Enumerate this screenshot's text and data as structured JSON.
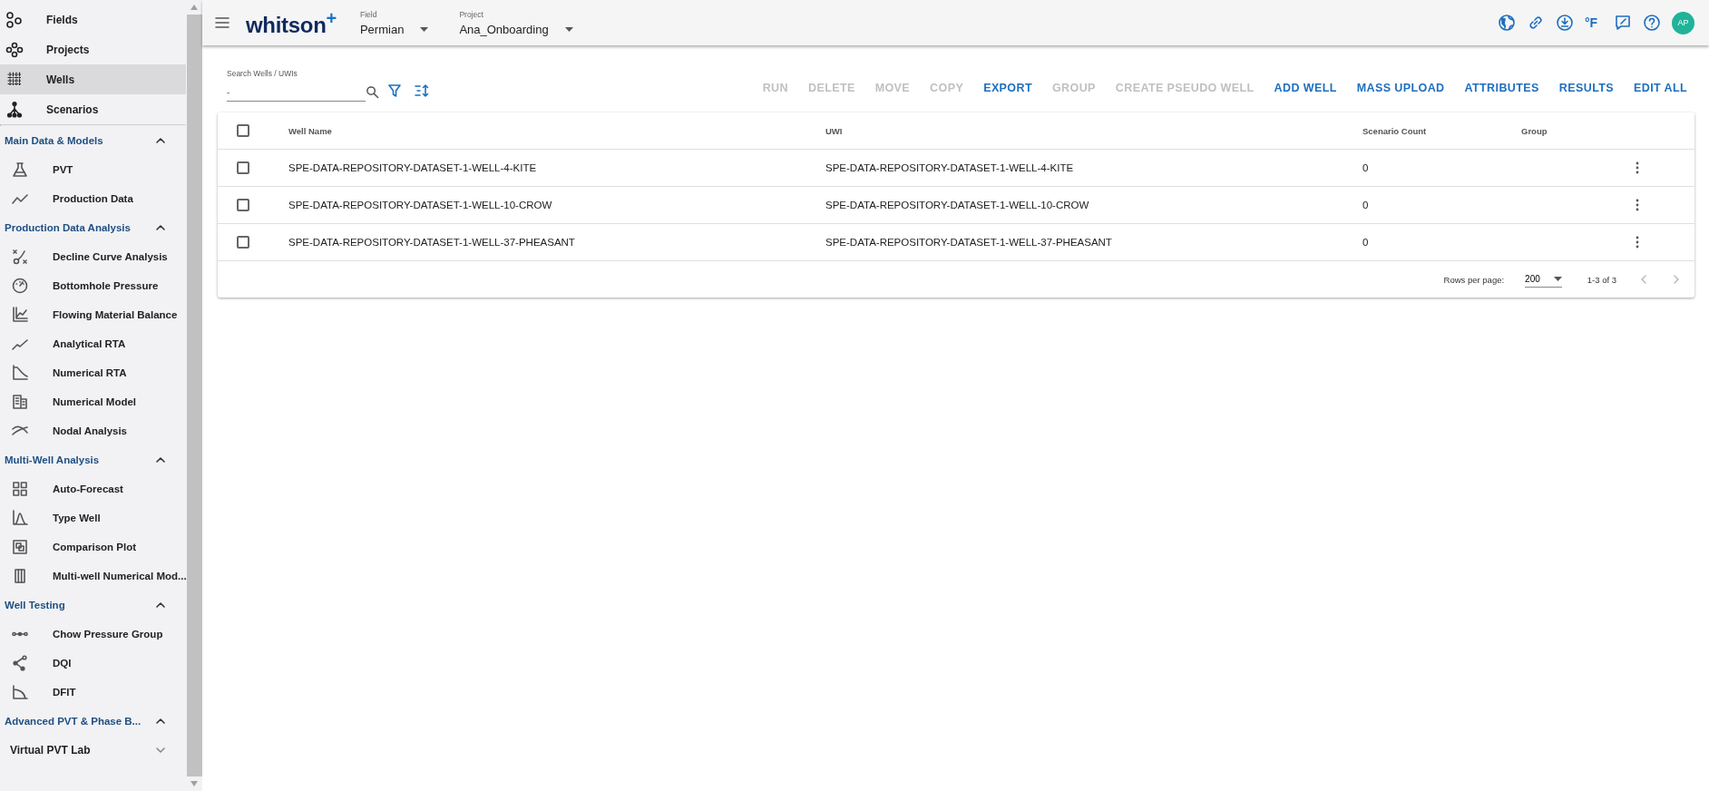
{
  "sidebar": {
    "nav_items": [
      {
        "label": "Fields",
        "selected": false
      },
      {
        "label": "Projects",
        "selected": false
      },
      {
        "label": "Wells",
        "selected": true
      },
      {
        "label": "Scenarios",
        "selected": false
      }
    ],
    "sections": [
      {
        "kind": "section",
        "title": "Main Data & Models",
        "expanded": true,
        "items": [
          {
            "label": "PVT"
          },
          {
            "label": "Production Data"
          }
        ]
      },
      {
        "kind": "section",
        "title": "Production Data Analysis",
        "expanded": true,
        "items": [
          {
            "label": "Decline Curve Analysis"
          },
          {
            "label": "Bottomhole Pressure"
          },
          {
            "label": "Flowing Material Balance"
          },
          {
            "label": "Analytical RTA"
          },
          {
            "label": "Numerical RTA"
          },
          {
            "label": "Numerical Model"
          },
          {
            "label": "Nodal Analysis"
          }
        ]
      },
      {
        "kind": "section",
        "title": "Multi-Well Analysis",
        "expanded": true,
        "items": [
          {
            "label": "Auto-Forecast"
          },
          {
            "label": "Type Well"
          },
          {
            "label": "Comparison Plot"
          },
          {
            "label": "Multi-well Numerical Mod..."
          }
        ]
      },
      {
        "kind": "section",
        "title": "Well Testing",
        "expanded": true,
        "items": [
          {
            "label": "Chow Pressure Group"
          },
          {
            "label": "DQI"
          },
          {
            "label": "DFIT"
          }
        ]
      },
      {
        "kind": "section",
        "title": "Advanced PVT & Phase B...",
        "expanded": true
      },
      {
        "kind": "subgroup",
        "title": "Virtual PVT Lab",
        "expanded": false
      }
    ]
  },
  "top_bar": {
    "logo": "whitson$^{+}$",
    "selectors": [
      {
        "label": "Field",
        "value": "Permian"
      },
      {
        "label": "Project",
        "value": "Ana_Onboarding"
      }
    ],
    "unit": "°F",
    "avatar": "AP"
  },
  "toolbar": {
    "search": {
      "label": "Search Wells / UWIs",
      "value": "-"
    },
    "actions": [
      {
        "label": "RUN",
        "disabled": true
      },
      {
        "label": "DELETE",
        "disabled": true
      },
      {
        "label": "MOVE",
        "disabled": true
      },
      {
        "label": "COPY",
        "disabled": true
      },
      {
        "label": "EXPORT",
        "disabled": false
      },
      {
        "label": "GROUP",
        "disabled": true
      },
      {
        "label": "CREATE PSEUDO WELL",
        "disabled": true
      },
      {
        "label": "ADD WELL",
        "disabled": false
      },
      {
        "label": "MASS UPLOAD",
        "disabled": false
      },
      {
        "label": "ATTRIBUTES",
        "disabled": false
      },
      {
        "label": "RESULTS",
        "disabled": false
      },
      {
        "label": "EDIT ALL",
        "disabled": false
      }
    ]
  },
  "table": {
    "all_checked": false,
    "columns": [
      "Well Name",
      "UWI",
      "Scenario Count",
      "Group"
    ],
    "rows": [
      {
        "checked": false,
        "cells": [
          "SPE-DATA-REPOSITORY-DATASET-1-WELL-4-KITE",
          "SPE-DATA-REPOSITORY-DATASET-1-WELL-4-KITE",
          "0"
        ]
      },
      {
        "checked": false,
        "cells": [
          "SPE-DATA-REPOSITORY-DATASET-1-WELL-10-CROW",
          "SPE-DATA-REPOSITORY-DATASET-1-WELL-10-CROW",
          "0"
        ]
      },
      {
        "checked": false,
        "cells": [
          "SPE-DATA-REPOSITORY-DATASET-1-WELL-37-PHEASANT",
          "SPE-DATA-REPOSITORY-DATASET-1-WELL-37-PHEASANT",
          "0"
        ]
      }
    ],
    "footer": {
      "rows_per_page_label": "Rows per page:",
      "rows_per_page": "200",
      "range": "1-3 of 3"
    }
  }
}
